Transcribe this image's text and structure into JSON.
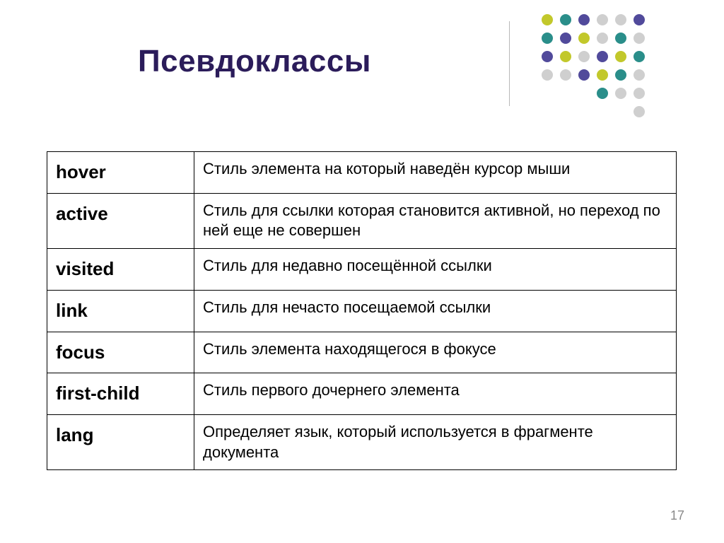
{
  "title": "Псевдоклассы",
  "page_number": "17",
  "table": {
    "rows": [
      {
        "key": "hover",
        "desc": "Стиль элемента на который наведён курсор мыши"
      },
      {
        "key": "active",
        "desc": "Стиль для ссылки которая становится активной, но переход по ней еще не совершен"
      },
      {
        "key": "visited",
        "desc": "Стиль для недавно посещённой ссылки"
      },
      {
        "key": "link",
        "desc": "Стиль для нечасто посещаемой ссылки"
      },
      {
        "key": "focus",
        "desc": "Стиль элемента находящегося в фокусе"
      },
      {
        "key": "first-child",
        "desc": "Стиль первого дочернего элемента"
      },
      {
        "key": "lang",
        "desc": "Определяет язык, который используется в фрагменте документа"
      }
    ]
  },
  "decoration": {
    "dot_colors": {
      "yellow": "#c2c82b",
      "teal": "#2a8e8a",
      "purple": "#514a9b",
      "grey": "#cfcfcf"
    }
  }
}
